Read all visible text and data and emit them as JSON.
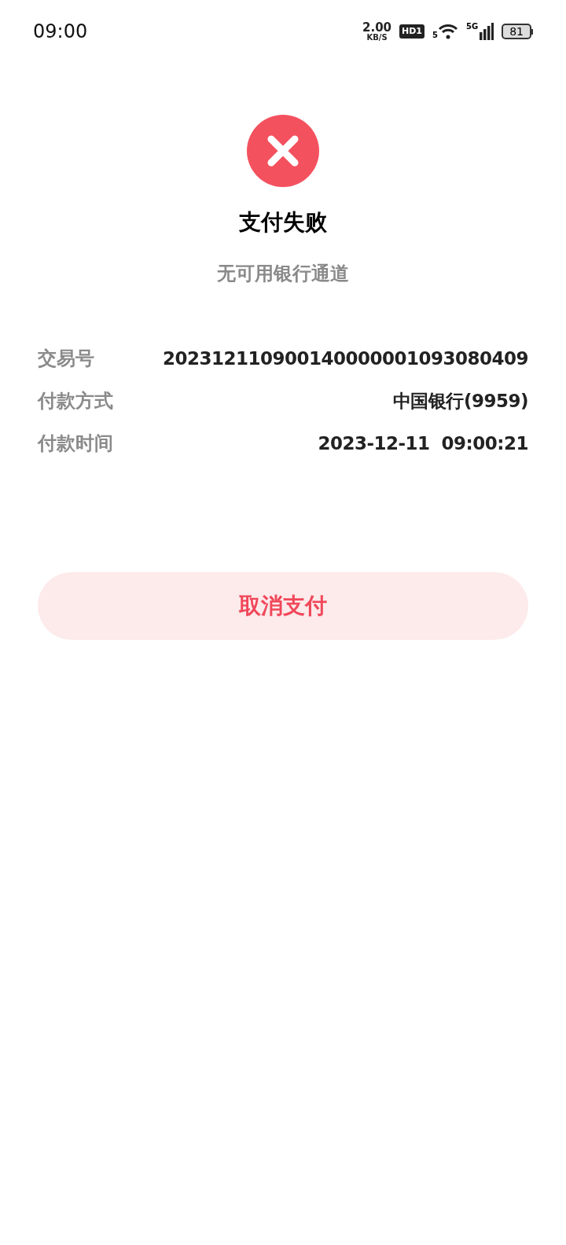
{
  "status_bar": {
    "time": "09:00",
    "speed_value": "2.00",
    "speed_unit": "KB/S",
    "hd_badge": "HD1",
    "wifi_band": "5",
    "network": "5G",
    "battery": "81"
  },
  "result": {
    "title": "支付失败",
    "message": "无可用银行通道"
  },
  "details": [
    {
      "label": "交易号",
      "value": "202312110900140000001093080409"
    },
    {
      "label": "付款方式",
      "value": "中国银行(9959)"
    },
    {
      "label": "付款时间",
      "value": "2023-12-11  09:00:21"
    }
  ],
  "buttons": [
    {
      "label": "取消支付"
    }
  ]
}
